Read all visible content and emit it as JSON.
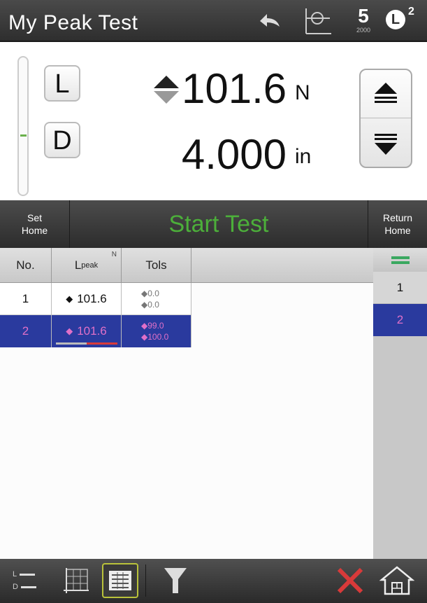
{
  "titlebar": {
    "title": "My Peak Test",
    "speed_value": "5",
    "speed_sub": "2000",
    "load_cell_label": "L",
    "load_cell_sup": "2"
  },
  "readout": {
    "load": {
      "channel": "L",
      "value": "101.6",
      "unit": "N"
    },
    "displacement": {
      "channel": "D",
      "value": "4.000",
      "unit": "in"
    }
  },
  "controls": {
    "set_home": [
      "Set",
      "Home"
    ],
    "start_test": "Start Test",
    "return_home": [
      "Return",
      "Home"
    ]
  },
  "table": {
    "headers": {
      "no": "No.",
      "lpeak_main": "L",
      "lpeak_sub": "peak",
      "lpeak_unit": "N",
      "tols": "Tols"
    },
    "rows": [
      {
        "no": "1",
        "lpeak": "101.6",
        "tol_upper": "0.0",
        "tol_lower": "0.0",
        "selected": false
      },
      {
        "no": "2",
        "lpeak": "101.6",
        "tol_upper": "99.0",
        "tol_lower": "100.0",
        "selected": true
      }
    ]
  },
  "results_list": {
    "items": [
      "1",
      "2"
    ],
    "selected": "2"
  },
  "bottombar": {
    "ld_top": "L",
    "ld_bottom": "D"
  },
  "colors": {
    "accent_green": "#4caf3a",
    "selection_blue": "#2a3a9e",
    "selection_text": "#e070c8",
    "delete_red": "#d83a3a"
  },
  "icons": [
    "undo-icon",
    "graph-view-icon",
    "speed-icon",
    "load-cell-icon",
    "direction-icon",
    "jog-up-icon",
    "jog-down-icon",
    "ld-display-icon",
    "graph-icon",
    "table-icon",
    "funnel-icon",
    "delete-icon",
    "home-icon"
  ]
}
